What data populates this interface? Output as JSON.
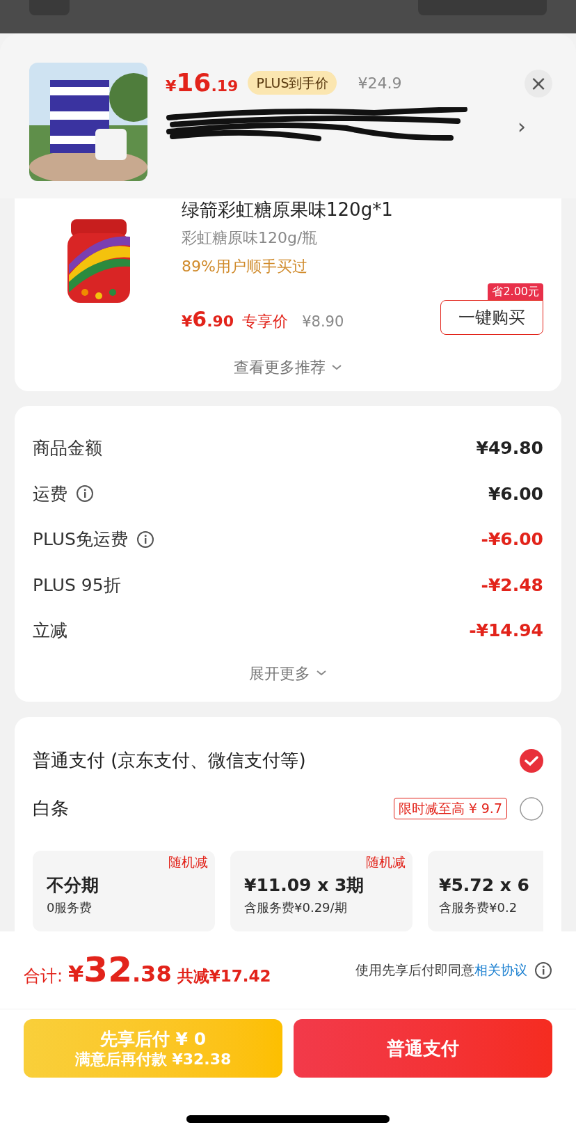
{
  "popup": {
    "price_symbol": "¥",
    "price_int": "16",
    "price_dec": ".19",
    "badge": "PLUS到手价",
    "original_price": "¥24.9",
    "close": "×",
    "chevron": "›"
  },
  "recommendation": {
    "title": "绿箭彩虹糖原果味120g*1",
    "spec": "彩虹糖原味120g/瓶",
    "social_proof": "89%用户顺手买过",
    "price_symbol": "¥",
    "price_int": "6",
    "price_dec": ".90",
    "price_label": "专享价",
    "original_price": "¥8.90",
    "save_badge": "省2.00元",
    "buy_button": "一键购买",
    "more_link": "查看更多推荐"
  },
  "summary": {
    "rows": [
      {
        "label": "商品金额",
        "info": false,
        "value": "¥49.80",
        "kind": "charge"
      },
      {
        "label": "运费",
        "info": true,
        "value": "¥6.00",
        "kind": "charge"
      },
      {
        "label": "PLUS免运费",
        "info": true,
        "value": "-¥6.00",
        "kind": "discount"
      },
      {
        "label": "PLUS 95折",
        "info": false,
        "value": "-¥2.48",
        "kind": "discount"
      },
      {
        "label": "立减",
        "info": false,
        "value": "-¥14.94",
        "kind": "discount"
      }
    ],
    "expand": "展开更多"
  },
  "payment": {
    "options": [
      {
        "label": "普通支付 (京东支付、微信支付等)",
        "selected": true
      },
      {
        "label": "白条",
        "promo": "限时减至高 ¥ 9.7",
        "selected": false
      }
    ],
    "plans": [
      {
        "tag": "随机减",
        "title": "不分期",
        "subtitle": "0服务费"
      },
      {
        "tag": "随机减",
        "title": "¥11.09 x 3期",
        "subtitle": "含服务费¥0.29/期"
      },
      {
        "title": "¥5.72 x 6",
        "subtitle": "含服务费¥0.2"
      }
    ]
  },
  "footer": {
    "total_label": "合计:",
    "total_symbol": "¥",
    "total_int": "32",
    "total_dec": ".38",
    "savings": "共减¥17.42",
    "agreement": "使用先享后付即同意",
    "agreement_link": "相关协议",
    "later_button": {
      "line1": "先享后付 ¥ 0",
      "line2": "满意后再付款 ¥32.38"
    },
    "pay_button": "普通支付"
  }
}
